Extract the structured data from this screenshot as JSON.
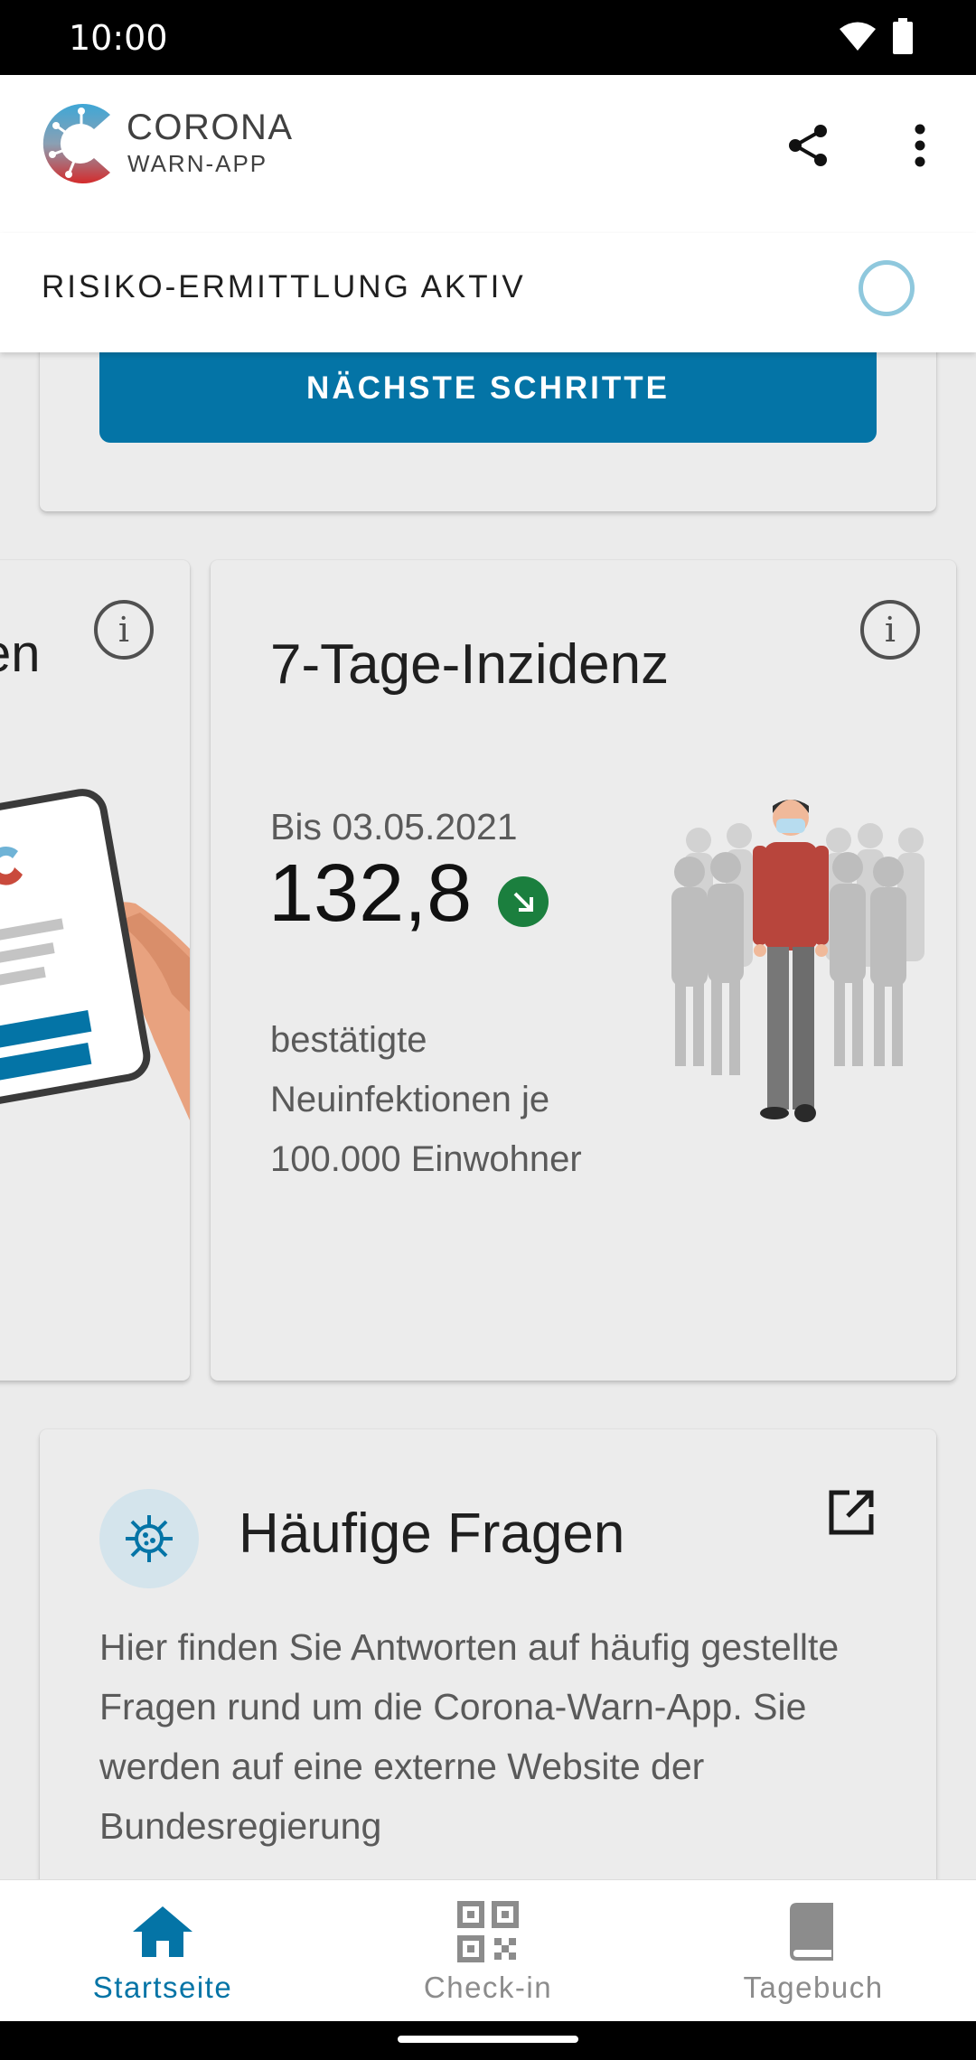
{
  "status_bar": {
    "time": "10:00"
  },
  "app_bar": {
    "logo_title": "CORONA",
    "logo_subtitle": "WARN-APP",
    "share_icon": "share-icon",
    "more_icon": "more-vert-icon"
  },
  "risk": {
    "label": "RISIKO-ERMITTLUNG AKTIV"
  },
  "next_steps": {
    "button_label": "NÄCHSTE SCHRITTE"
  },
  "left_card": {
    "title_fragment": "en"
  },
  "incidence": {
    "title": "7-Tage-Inzidenz",
    "date_label": "Bis 03.05.2021",
    "value": "132,8",
    "trend": "down",
    "description": "bestätigte Neuinfektionen je 100.000 Einwohner"
  },
  "faq": {
    "title": "Häufige Fragen",
    "description": "Hier finden Sie Antworten auf häufig gestellte Fragen rund um die Corona-Warn-App. Sie werden auf eine externe Website der Bundesregierung"
  },
  "bottom_nav": {
    "items": [
      {
        "label": "Startseite",
        "icon": "home-icon",
        "active": true
      },
      {
        "label": "Check-in",
        "icon": "qr-code-icon",
        "active": false
      },
      {
        "label": "Tagebuch",
        "icon": "book-icon",
        "active": false
      }
    ]
  },
  "colors": {
    "primary": "#0474a6",
    "trend_down": "#1b7f3e",
    "spinner": "#8fc8dd",
    "card_bg": "#ececec"
  }
}
